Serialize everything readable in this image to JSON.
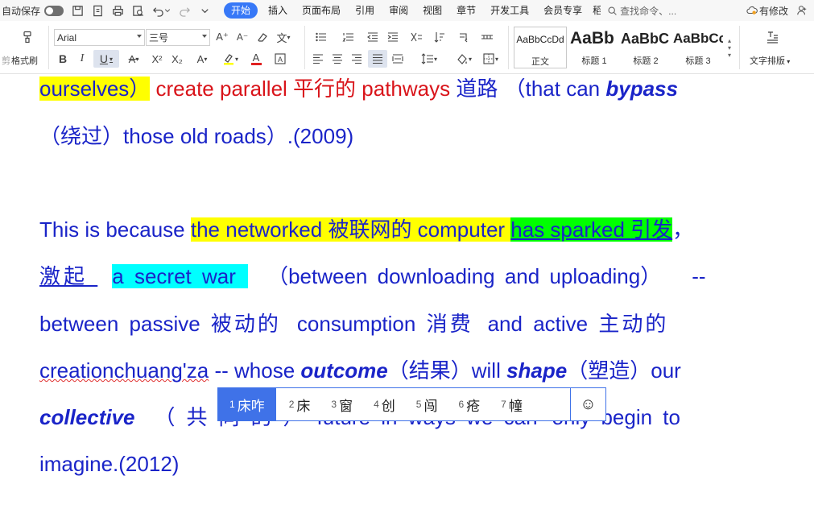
{
  "topbar": {
    "autosave_label": "自动保存",
    "menu": [
      {
        "label": "开始",
        "active": true
      },
      {
        "label": "插入"
      },
      {
        "label": "页面布局"
      },
      {
        "label": "引用"
      },
      {
        "label": "审阅"
      },
      {
        "label": "视图"
      },
      {
        "label": "章节"
      },
      {
        "label": "开发工具"
      },
      {
        "label": "会员专享"
      },
      {
        "label": "稻"
      }
    ],
    "search_placeholder": "查找命令、...",
    "changes_label": "有修改"
  },
  "ribbon": {
    "format_painter_label": "格式刷",
    "font_name": "Arial",
    "font_size": "三号",
    "styles": [
      {
        "sample": "AaBbCcDd",
        "name": "正文"
      },
      {
        "sample": "AaBb",
        "name": "标题 1"
      },
      {
        "sample": "AaBbC",
        "name": "标题 2"
      },
      {
        "sample": "AaBbCc",
        "name": "标题 3"
      }
    ],
    "text_layout_label": "文字排版"
  },
  "document": {
    "line1": {
      "a": "ourselves）",
      "b": " create parallel ",
      "c": "平行的",
      "d": " pathways ",
      "e": "道路 （",
      "f": "that can ",
      "g": "bypass"
    },
    "line2": {
      "a": "（绕过）",
      "b": "those old roads）.(2009)"
    },
    "line3": {
      "a": "This is because ",
      "b": "the networked ",
      "c": "被联网的",
      "d": " computer ",
      "e": "has sparked ",
      "f": "引发",
      "g": "，"
    },
    "line4": {
      "a": "激起 ",
      "b": " a secret war ",
      "c": "（between downloading and uploading）",
      "d": "--"
    },
    "line5": {
      "a": "between passive ",
      "b": "被动的",
      "c": "consumption ",
      "d": "消费",
      "e": "and active ",
      "f": "主动的"
    },
    "line6": {
      "a": "creationchuang'za",
      "b": " -- whose ",
      "c": "outcome",
      "d": "（结果）",
      "e": "will ",
      "f": "shape",
      "g": "（塑造）",
      "h": "our"
    },
    "line7": {
      "a": "collective",
      "b": "（共同的）",
      "c": "future in ways we can",
      "d": "only begin to"
    },
    "line8": {
      "a": "imagine.(2012)"
    }
  },
  "ime": {
    "candidates": [
      {
        "num": "1",
        "text": "床咋"
      },
      {
        "num": "2",
        "text": "床"
      },
      {
        "num": "3",
        "text": "窗"
      },
      {
        "num": "4",
        "text": "创"
      },
      {
        "num": "5",
        "text": "闯"
      },
      {
        "num": "6",
        "text": "疮"
      },
      {
        "num": "7",
        "text": "幢"
      }
    ],
    "emoji_glyph": "☺"
  },
  "colors": {
    "text_blue": "#1a24c8",
    "text_red": "#d9141a",
    "highlight_yellow": "#ffff00",
    "highlight_green": "#00ff00",
    "highlight_cyan": "#00ffff",
    "accent": "#3778f7"
  }
}
